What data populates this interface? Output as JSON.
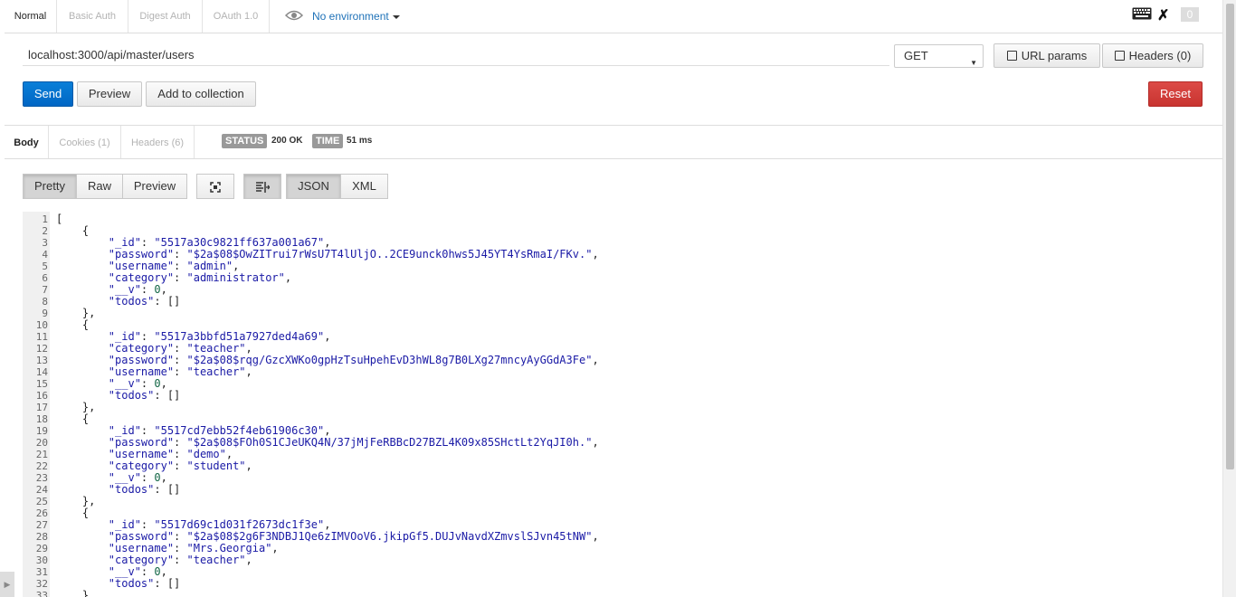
{
  "auth_tabs": [
    "Normal",
    "Basic Auth",
    "Digest Auth",
    "OAuth 1.0"
  ],
  "environment": "No environment",
  "counter": "0",
  "request": {
    "url": "localhost:3000/api/master/users",
    "method": "GET",
    "url_params_label": "URL params",
    "headers_label": "Headers (0)",
    "send_label": "Send",
    "preview_label": "Preview",
    "add_collection_label": "Add to collection",
    "reset_label": "Reset"
  },
  "response": {
    "tabs": [
      "Body",
      "Cookies (1)",
      "Headers (6)"
    ],
    "status_label": "STATUS",
    "status_value": "200 OK",
    "time_label": "TIME",
    "time_value": "51 ms"
  },
  "viewer": {
    "modes": [
      "Pretty",
      "Raw",
      "Preview"
    ],
    "formats": [
      "JSON",
      "XML"
    ]
  },
  "code_lines": [
    "[",
    "    {",
    "        \"_id\": \"5517a30c9821ff637a001a67\",",
    "        \"password\": \"$2a$08$OwZITrui7rWsU7T4lUljO..2CE9unck0hws5J45YT4YsRmaI/FKv.\",",
    "        \"username\": \"admin\",",
    "        \"category\": \"administrator\",",
    "        \"__v\": 0,",
    "        \"todos\": []",
    "    },",
    "    {",
    "        \"_id\": \"5517a3bbfd51a7927ded4a69\",",
    "        \"category\": \"teacher\",",
    "        \"password\": \"$2a$08$rqg/GzcXWKo0gpHzTsuHpehEvD3hWL8g7B0LXg27mncyAyGGdA3Fe\",",
    "        \"username\": \"teacher\",",
    "        \"__v\": 0,",
    "        \"todos\": []",
    "    },",
    "    {",
    "        \"_id\": \"5517cd7ebb52f4eb61906c30\",",
    "        \"password\": \"$2a$08$FOh0S1CJeUKQ4N/37jMjFeRBBcD27BZL4K09x85SHctLt2YqJI0h.\",",
    "        \"username\": \"demo\",",
    "        \"category\": \"student\",",
    "        \"__v\": 0,",
    "        \"todos\": []",
    "    },",
    "    {",
    "        \"_id\": \"5517d69c1d031f2673dc1f3e\",",
    "        \"password\": \"$2a$08$2g6F3NDBJ1Qe6zIMVOoV6.jkipGf5.DUJvNavdXZmvslSJvn45tNW\",",
    "        \"username\": \"Mrs.Georgia\",",
    "        \"category\": \"teacher\",",
    "        \"__v\": 0,",
    "        \"todos\": []",
    "    }"
  ]
}
